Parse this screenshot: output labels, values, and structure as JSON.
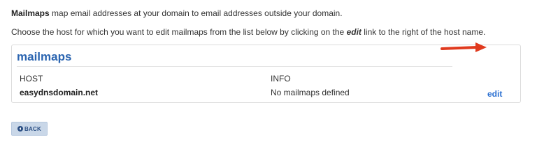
{
  "intro": {
    "bold_term": "Mailmaps",
    "sentence": " map email addresses at your domain to email addresses outside your domain."
  },
  "instructions": {
    "before": "Choose the host for which you want to edit mailmaps from the list below by clicking on the ",
    "emphasis": "edit",
    "after": " link to the right of the host name."
  },
  "panel": {
    "title": "mailmaps",
    "columns": {
      "host": "HOST",
      "info": "INFO"
    },
    "rows": [
      {
        "host": "easydnsdomain.net",
        "info": "No mailmaps defined",
        "action": "edit"
      }
    ]
  },
  "back_button": {
    "label": "BACK",
    "icon": "back-circle-icon"
  },
  "colors": {
    "title_blue": "#2a64b0",
    "link_blue": "#2a6fd1",
    "annotation_arrow": "#e03a1e",
    "button_bg": "#c9d7e8"
  }
}
